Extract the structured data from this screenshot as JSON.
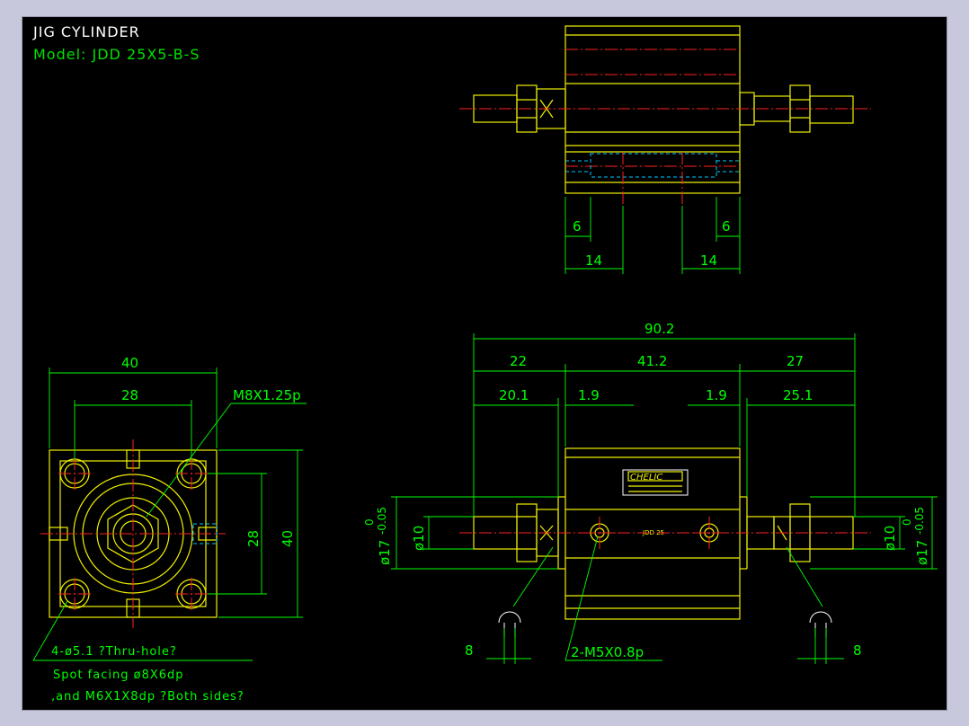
{
  "drawing": {
    "title": "JIG CYLINDER",
    "model": "Model:  JDD 25X5-B-S"
  },
  "top_view": {
    "dims": [
      "6",
      "6",
      "14",
      "14"
    ]
  },
  "front_view": {
    "overall": "90.2",
    "seg_top": [
      "22",
      "41.2",
      "27"
    ],
    "seg_bottom": [
      "20.1",
      "1.9",
      "1.9",
      "25.1"
    ],
    "left_diam": "ø10",
    "left_tol_dim": "ø17",
    "left_tol_upper": "0",
    "left_tol_lower": "-0.05",
    "right_diam": "ø10",
    "right_tol_dim": "ø17",
    "right_tol_upper": "0",
    "right_tol_lower": "-0.05",
    "port_label": "2-M5X0.8p",
    "left_dim": "8",
    "right_dim": "8",
    "brand": "CHELIC",
    "brand_small": "...",
    "body_text": "JDD 25"
  },
  "side_view": {
    "width_outer": "40",
    "width_inner": "28",
    "height_inner": "28",
    "height_outer": "40",
    "thread_label": "M8X1.25p",
    "note1": "4-ø5.1 ?Thru-hole?",
    "note2": "Spot facing  ø8X6dp",
    "note3": ",and M6X1X8dp ?Both sides?"
  },
  "colors": {
    "outline": "#f0f000",
    "dimension": "#00ff00",
    "centerline": "#ff2020",
    "hidden": "#00c8ff",
    "background": "#000000"
  }
}
